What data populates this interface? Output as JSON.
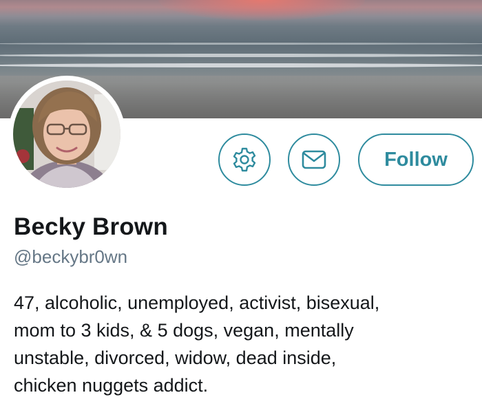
{
  "profile": {
    "display_name": "Becky Brown",
    "handle": "@beckybr0wn",
    "bio_lines": [
      "47, alcoholic, unemployed, activist, bisexual,",
      "mom to 3 kids, & 5 dogs, vegan, mentally",
      "unstable, divorced, widow, dead inside,",
      "chicken nuggets addict."
    ]
  },
  "actions": {
    "settings_icon": "gear-icon",
    "message_icon": "envelope-icon",
    "follow_label": "Follow"
  },
  "colors": {
    "accent": "#2e8b9e",
    "name_text": "#14171a",
    "handle_text": "#657786",
    "background": "#ffffff"
  }
}
